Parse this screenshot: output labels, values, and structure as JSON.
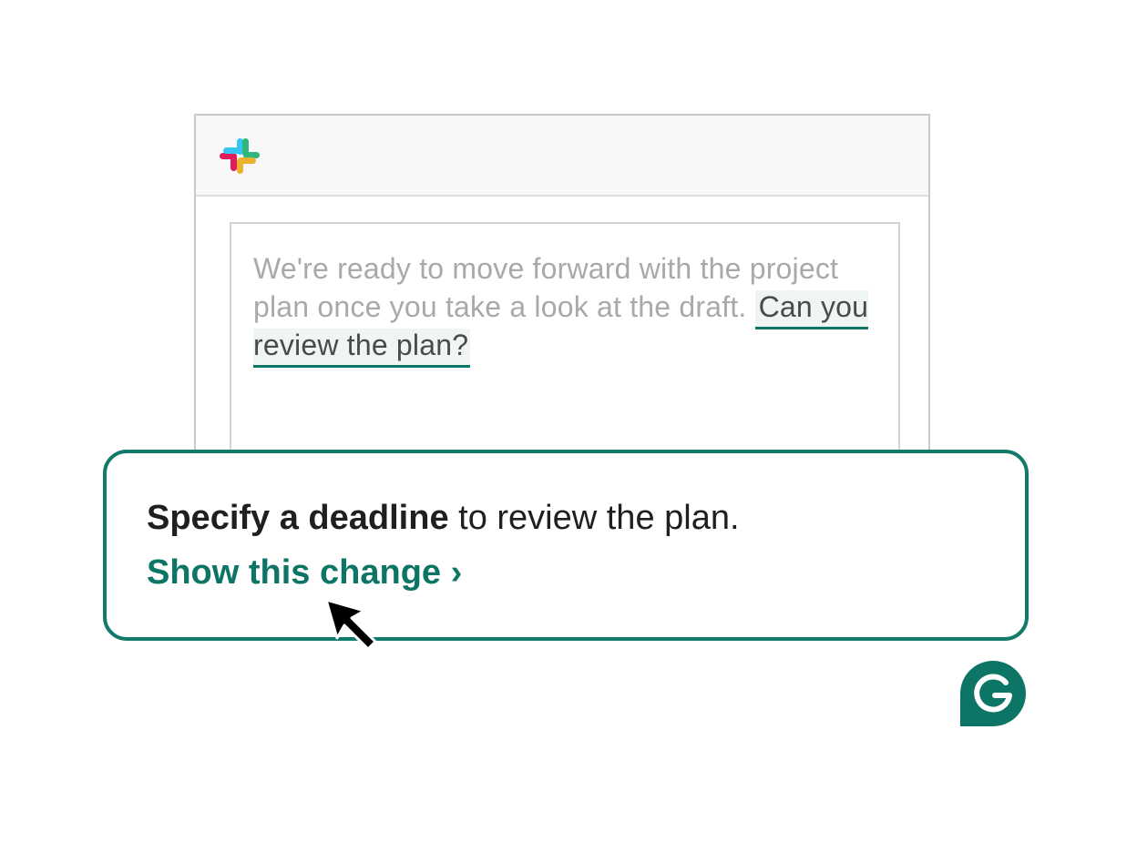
{
  "app": {
    "name": "Slack",
    "logo_icon": "slack-logo-icon",
    "colors": {
      "blue": "#36c5f0",
      "green": "#2eb67d",
      "yellow": "#ecb22e",
      "red": "#e01e5a"
    }
  },
  "message": {
    "plain_text": "We're ready to move forward with the project plan once you take a look at the draft. ",
    "highlighted_text": "Can you review the plan?"
  },
  "suggestion": {
    "bold_text": "Specify a deadline",
    "rest_text": " to review the plan.",
    "action_label": "Show this change ›"
  },
  "brand": {
    "name": "Grammarly",
    "accent_color": "#0c7565",
    "logo_icon": "grammarly-logo-icon"
  },
  "cursor_icon": "arrow-cursor-icon"
}
